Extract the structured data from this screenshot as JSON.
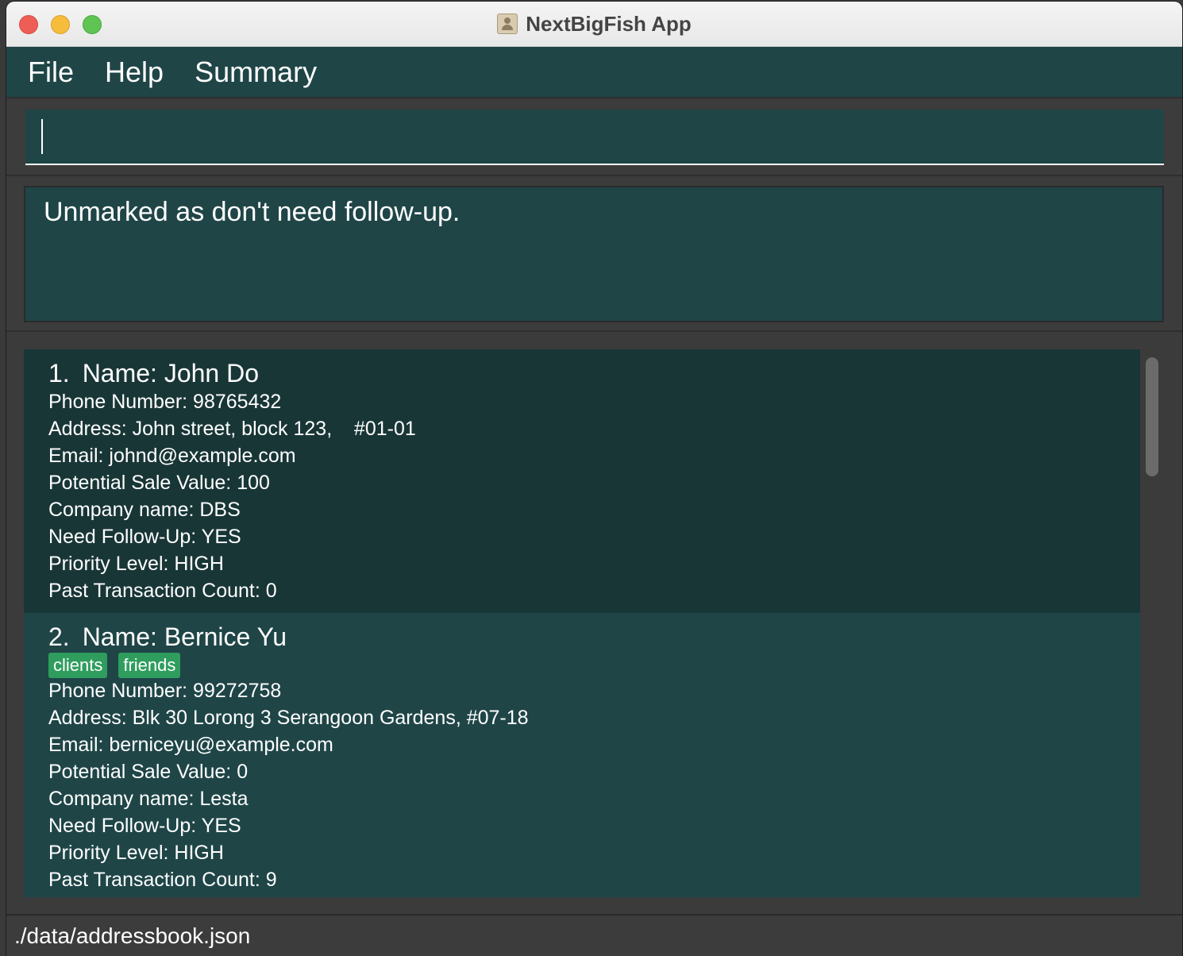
{
  "window": {
    "title": "NextBigFish App"
  },
  "menu": {
    "items": [
      {
        "label": "File"
      },
      {
        "label": "Help"
      },
      {
        "label": "Summary"
      }
    ]
  },
  "command_box": {
    "value": "",
    "placeholder": ""
  },
  "result_display": {
    "text": "Unmarked as don't need follow-up."
  },
  "persons": [
    {
      "index": "1.",
      "name": "Name: John Do",
      "tags": [],
      "phone": "Phone Number: 98765432",
      "address": "Address: John street, block 123,    #01-01",
      "email": "Email: johnd@example.com",
      "potential_sale_value": "Potential Sale Value: 100",
      "company": "Company name: DBS",
      "follow_up": "Need Follow-Up: YES",
      "priority": "Priority Level: HIGH",
      "transaction_count": "Past Transaction Count: 0"
    },
    {
      "index": "2.",
      "name": "Name: Bernice Yu",
      "tags": [
        "clients",
        "friends"
      ],
      "phone": "Phone Number: 99272758",
      "address": "Address: Blk 30 Lorong 3 Serangoon Gardens, #07-18",
      "email": "Email: berniceyu@example.com",
      "potential_sale_value": "Potential Sale Value: 0",
      "company": "Company name: Lesta",
      "follow_up": "Need Follow-Up: YES",
      "priority": "Priority Level: HIGH",
      "transaction_count": "Past Transaction Count: 9"
    }
  ],
  "status_bar": {
    "file_path": "./data/addressbook.json"
  },
  "colors": {
    "panel": "#1f4547",
    "selected_card": "#193637",
    "background": "#3b3b3b",
    "tag": "#2f9d5e",
    "text": "#ffffff"
  }
}
